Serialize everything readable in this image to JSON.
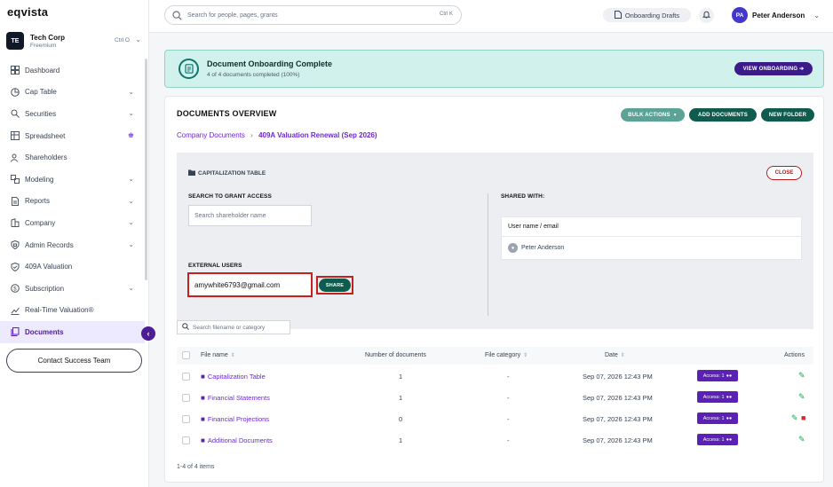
{
  "brand": {
    "logo": "eqvista"
  },
  "company": {
    "initials": "TE",
    "name": "Tech Corp",
    "plan": "Freemium",
    "shortcut": "Ctrl O"
  },
  "sidebar": {
    "items": [
      {
        "label": "Dashboard",
        "icon": "dashboard-icon",
        "chevron": false
      },
      {
        "label": "Cap Table",
        "icon": "cap-table-icon",
        "chevron": true
      },
      {
        "label": "Securities",
        "icon": "securities-icon",
        "chevron": true
      },
      {
        "label": "Spreadsheet",
        "icon": "spreadsheet-icon",
        "chevron": false,
        "crown": true
      },
      {
        "label": "Shareholders",
        "icon": "shareholders-icon",
        "chevron": false
      },
      {
        "label": "Modeling",
        "icon": "modeling-icon",
        "chevron": true
      },
      {
        "label": "Reports",
        "icon": "reports-icon",
        "chevron": true
      },
      {
        "label": "Company",
        "icon": "company-icon",
        "chevron": true
      },
      {
        "label": "Admin Records",
        "icon": "admin-records-icon",
        "chevron": true
      },
      {
        "label": "409A Valuation",
        "icon": "shield-icon",
        "chevron": false
      },
      {
        "label": "Subscription",
        "icon": "subscription-icon",
        "chevron": true
      },
      {
        "label": "Real-Time Valuation®",
        "icon": "trend-icon",
        "chevron": false
      },
      {
        "label": "Documents",
        "icon": "documents-icon",
        "chevron": false,
        "active": true
      }
    ],
    "contact_label": "Contact Success Team"
  },
  "topbar": {
    "search_placeholder": "Search for people, pages, grants",
    "search_shortcut": "Ctrl K",
    "drafts_label": "Onboarding Drafts",
    "user_initials": "PA",
    "user_name": "Peter Anderson"
  },
  "banner": {
    "title": "Document Onboarding Complete",
    "subtitle": "4 of 4 documents completed (100%)",
    "button": "VIEW ONBOARDING ➔"
  },
  "overview": {
    "title": "DOCUMENTS OVERVIEW",
    "bulk_label": "BULK ACTIONS",
    "add_label": "ADD DOCUMENTS",
    "new_folder_label": "NEW FOLDER",
    "breadcrumb": {
      "root": "Company Documents",
      "current": "409A Valuation Renewal (Sep 2026)"
    }
  },
  "share_panel": {
    "title": "CAPITALIZATION TABLE",
    "close_label": "CLOSE",
    "search_label": "SEARCH TO GRANT ACCESS",
    "search_placeholder": "Search shareholder name",
    "external_label": "EXTERNAL USERS",
    "external_value": "amywhite6793@gmail.com",
    "share_label": "SHARE",
    "shared_with_label": "SHARED WITH:",
    "shared_header": "User name / email",
    "shared_users": [
      "Peter Anderson"
    ]
  },
  "files": {
    "search_placeholder": "Search filename or category",
    "headers": {
      "name": "File name",
      "count": "Number of documents",
      "category": "File category",
      "date": "Date",
      "actions": "Actions"
    },
    "rows": [
      {
        "name": "Capitalization Table",
        "count": "1",
        "category": "-",
        "date": "Sep 07, 2026 12:43 PM",
        "access": "Access: 1",
        "delete": false
      },
      {
        "name": "Financial Statements",
        "count": "1",
        "category": "-",
        "date": "Sep 07, 2026 12:43 PM",
        "access": "Access: 1",
        "delete": false
      },
      {
        "name": "Financial Projections",
        "count": "0",
        "category": "-",
        "date": "Sep 07, 2026 12:43 PM",
        "access": "Access: 1",
        "delete": true
      },
      {
        "name": "Additional Documents",
        "count": "1",
        "category": "-",
        "date": "Sep 07, 2026 12:43 PM",
        "access": "Access: 1",
        "delete": false
      }
    ],
    "pager": "1-4 of 4 items"
  },
  "colors": {
    "accent": "#4c1d95",
    "success": "#0f5c4f",
    "highlight": "#c81e1e",
    "banner_bg": "#d1f2ec"
  }
}
